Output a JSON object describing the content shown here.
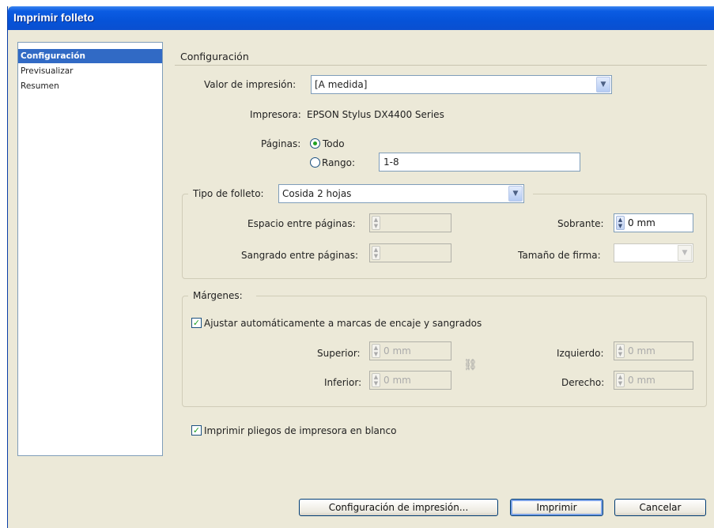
{
  "window": {
    "title": "Imprimir folleto"
  },
  "sidebar": {
    "items": [
      "Configuración",
      "Previsualizar",
      "Resumen"
    ],
    "selected": 0
  },
  "section": {
    "title": "Configuración"
  },
  "print_preset": {
    "label": "Valor de impresión:",
    "value": "[A medida]"
  },
  "printer": {
    "label": "Impresora:",
    "value": "EPSON Stylus DX4400 Series"
  },
  "pages": {
    "label": "Páginas:",
    "all_label": "Todo",
    "range_label": "Rango:",
    "range_value": "1-8",
    "selected": "all"
  },
  "booklet": {
    "type_label": "Tipo de folleto:",
    "type_value": "Cosida 2 hojas",
    "space_label": "Espacio entre páginas:",
    "bleed_label": "Sangrado entre páginas:",
    "creep_label": "Sobrante:",
    "creep_value": "0 mm",
    "signature_label": "Tamaño de firma:"
  },
  "margins": {
    "group_label": "Márgenes:",
    "auto_label": "Ajustar automáticamente a marcas de encaje y sangrados",
    "auto_checked": true,
    "top_label": "Superior:",
    "top_value": "0 mm",
    "bottom_label": "Inferior:",
    "bottom_value": "0 mm",
    "left_label": "Izquierdo:",
    "left_value": "0 mm",
    "right_label": "Derecho:",
    "right_value": "0 mm"
  },
  "blank_spreads": {
    "label": "Imprimir pliegos de impresora en blanco",
    "checked": true
  },
  "buttons": {
    "setup": "Configuración de impresión...",
    "print": "Imprimir",
    "cancel": "Cancelar"
  }
}
